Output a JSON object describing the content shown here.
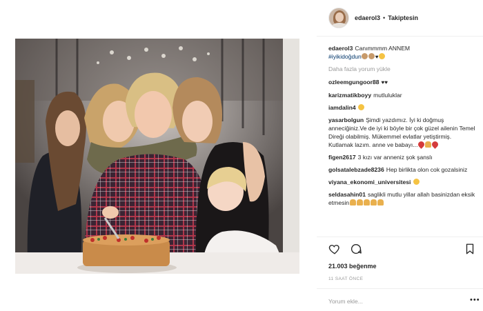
{
  "post": {
    "username": "edaerol3",
    "separator": "•",
    "follow_status": "Takiptesin",
    "caption": {
      "username": "edaerol3",
      "text": "Canımmmm ANNEM",
      "hashtag": "#iyikidoğdun"
    },
    "load_more": "Daha fazla yorum yükle",
    "comments": [
      {
        "username": "ozleemgungoor88",
        "text": ""
      },
      {
        "username": "karizmatikboyy",
        "text": "mutluluklar"
      },
      {
        "username": "iamdalin4",
        "text": ""
      },
      {
        "username": "yasarbolgun",
        "text": "Şimdi yazdımız. İyi ki doğmuş anneciğiniz.Ve de iyi ki böyle bir çok güzel ailenin Temel Direği olabilmiş. Mükemmel evlatlar yetiştirmiş. Kutlamak lazım. anne ve babayı..."
      },
      {
        "username": "figen2617",
        "text": "3 kızı var anneniz şok şanslı"
      },
      {
        "username": "golsatalebzade8236",
        "text": "Hep birlikta olon cok gozalsiniz"
      },
      {
        "username": "viyana_ekonomi_universitesi",
        "text": ""
      },
      {
        "username": "seldasahin01",
        "text": "saglikli mutlu yillar allah basinizdan eksik etmesin"
      }
    ],
    "likes": "21.003 beğenme",
    "time_ago": "11 SAAT ÖNCE",
    "add_comment_placeholder": "Yorum ekle...",
    "more_options": "•••"
  },
  "icons": {
    "like": "heart-outline",
    "comment": "speech-bubble",
    "save": "bookmark"
  },
  "colors": {
    "text": "#262626",
    "muted": "#999999",
    "hashtag": "#003569",
    "divider": "#efefef"
  }
}
